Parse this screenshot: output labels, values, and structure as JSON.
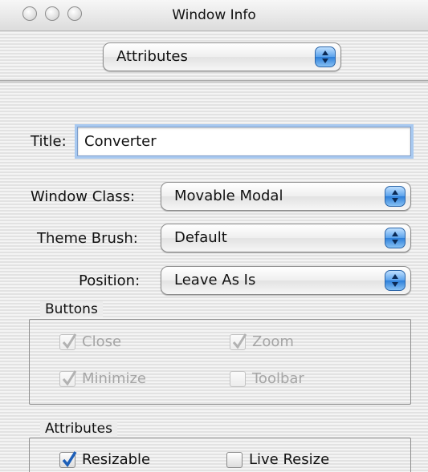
{
  "window": {
    "title": "Window Info"
  },
  "header": {
    "popup_value": "Attributes"
  },
  "form": {
    "title_label": "Title:",
    "title_value": "Converter",
    "window_class_label": "Window Class:",
    "window_class_value": "Movable Modal",
    "theme_brush_label": "Theme Brush:",
    "theme_brush_value": "Default",
    "position_label": "Position:",
    "position_value": "Leave As Is"
  },
  "buttons_group": {
    "title": "Buttons",
    "items": [
      {
        "label": "Close",
        "checked": true,
        "enabled": false
      },
      {
        "label": "Zoom",
        "checked": true,
        "enabled": false
      },
      {
        "label": "Minimize",
        "checked": true,
        "enabled": false
      },
      {
        "label": "Toolbar",
        "checked": false,
        "enabled": false
      }
    ]
  },
  "attributes_group": {
    "title": "Attributes",
    "items": [
      {
        "label": "Resizable",
        "checked": true,
        "enabled": true
      },
      {
        "label": "Live Resize",
        "checked": false,
        "enabled": true
      }
    ]
  },
  "colors": {
    "accent_blue": "#3d8ee6",
    "disabled_text": "#a5a5a5",
    "background": "#ececec"
  }
}
